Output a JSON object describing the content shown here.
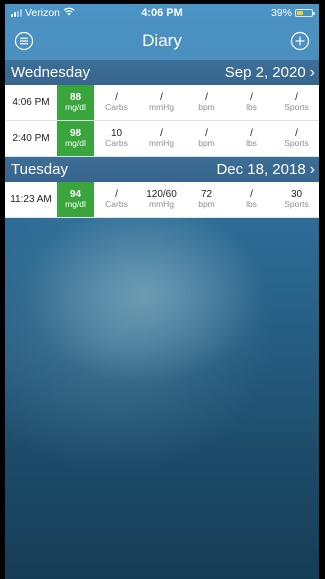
{
  "status": {
    "carrier": "Verizon",
    "time": "4:06 PM",
    "battery": "39%",
    "battery_color": "#f4d21f"
  },
  "nav": {
    "title": "Diary",
    "left_icon": "menu-circle-icon",
    "right_icon": "plus-circle-icon"
  },
  "colors": {
    "accent": "#4a91c2",
    "glucose_ok": "#3aa53c"
  },
  "days": [
    {
      "name": "Wednesday",
      "date": "Sep 2, 2020",
      "entries": [
        {
          "time": "4:06 PM",
          "glucose": "88",
          "glucose_unit": "mg/dl",
          "carbs": "/",
          "carbs_unit": "Carbs",
          "bp": "/",
          "bp_unit": "mmHg",
          "pulse": "/",
          "pulse_unit": "bpm",
          "weight": "/",
          "weight_unit": "lbs",
          "sports": "/",
          "sports_unit": "Sports"
        },
        {
          "time": "2:40 PM",
          "glucose": "98",
          "glucose_unit": "mg/dl",
          "carbs": "10",
          "carbs_unit": "Carbs",
          "bp": "/",
          "bp_unit": "mmHg",
          "pulse": "/",
          "pulse_unit": "bpm",
          "weight": "/",
          "weight_unit": "lbs",
          "sports": "/",
          "sports_unit": "Sports"
        }
      ]
    },
    {
      "name": "Tuesday",
      "date": "Dec 18, 2018",
      "entries": [
        {
          "time": "11:23 AM",
          "glucose": "94",
          "glucose_unit": "mg/dl",
          "carbs": "/",
          "carbs_unit": "Carbs",
          "bp": "120/60",
          "bp_unit": "mmHg",
          "pulse": "72",
          "pulse_unit": "bpm",
          "weight": "/",
          "weight_unit": "lbs",
          "sports": "30",
          "sports_unit": "Sports"
        }
      ]
    }
  ]
}
